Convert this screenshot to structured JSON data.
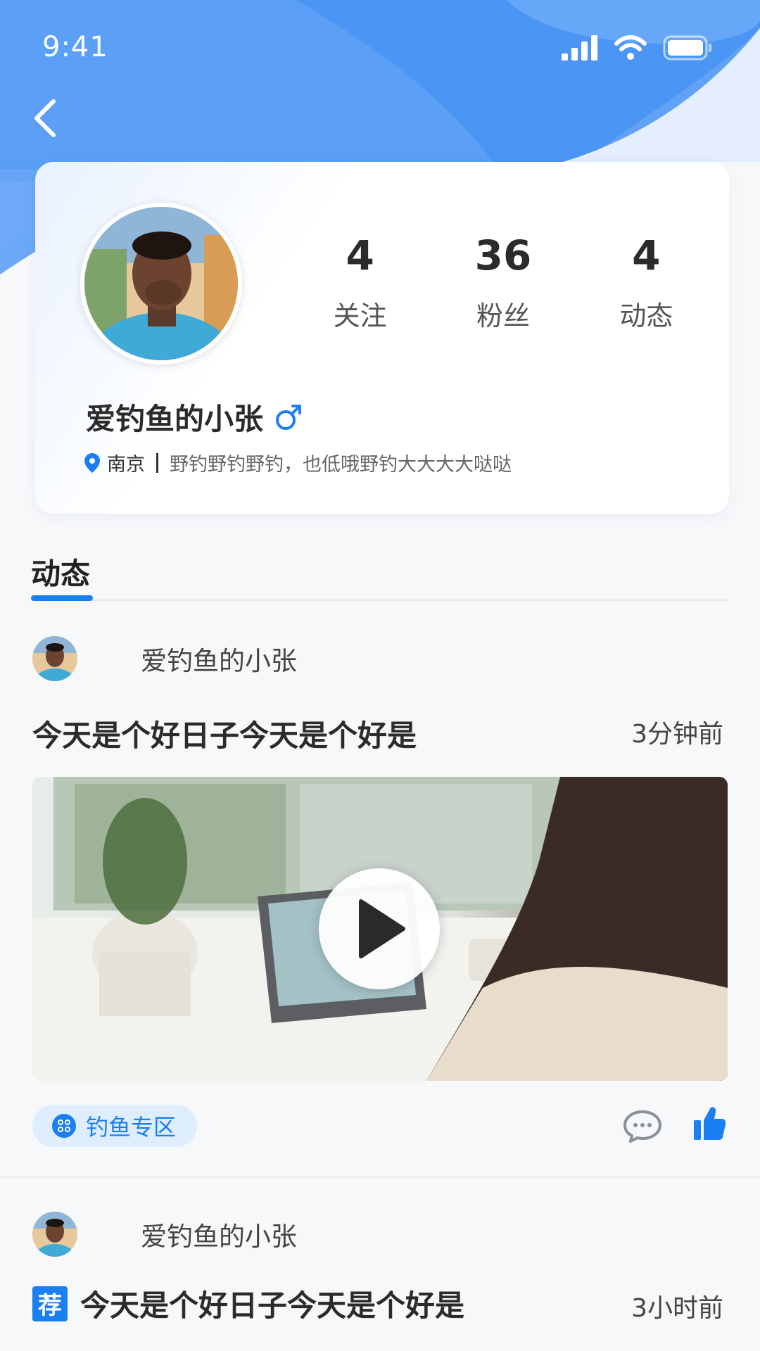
{
  "status_bar": {
    "time": "9:41"
  },
  "colors": {
    "accent": "#1a7ff0",
    "hero_blue": "#3c8cf2",
    "text": "#2b2b2b"
  },
  "profile": {
    "stats": [
      {
        "value": "4",
        "label": "关注"
      },
      {
        "value": "36",
        "label": "粉丝"
      },
      {
        "value": "4",
        "label": "动态"
      }
    ],
    "username": "爱钓鱼的小张",
    "gender_icon": "male-icon",
    "location": "南京",
    "bio": "野钓野钓野钓，也低哦野钓大大大大哒哒"
  },
  "tabs": {
    "active": "动态"
  },
  "posts": [
    {
      "author": "爱钓鱼的小张",
      "title": "今天是个好日子今天是个好是",
      "time": "3分钟前",
      "media": "video",
      "tag": "钓鱼专区"
    },
    {
      "author": "爱钓鱼的小张",
      "badge": "荐",
      "title": "今天是个好日子今天是个好是",
      "time": "3小时前"
    }
  ]
}
